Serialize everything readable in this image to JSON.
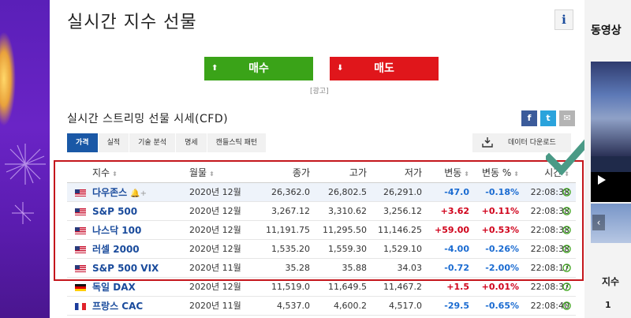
{
  "page": {
    "title": "실시간 지수 선물",
    "info_label": "i"
  },
  "actions": {
    "buy_label": "매수",
    "sell_label": "매도",
    "ad_label": "[광고]"
  },
  "section": {
    "title": "실시간 스트리밍 선물 시세(CFD)",
    "share": {
      "facebook": "f",
      "twitter": "t",
      "email": "✉"
    }
  },
  "tabs": [
    {
      "label": "가격",
      "active": true
    },
    {
      "label": "실적",
      "active": false
    },
    {
      "label": "기술 분석",
      "active": false
    },
    {
      "label": "명세",
      "active": false
    },
    {
      "label": "캔들스틱 패턴",
      "active": false
    }
  ],
  "download": {
    "label": "데이터 다운로드"
  },
  "table": {
    "headers": {
      "name": "지수",
      "month": "월물",
      "close": "종가",
      "high": "고가",
      "low": "저가",
      "change": "변동",
      "change_pct": "변동 %",
      "time": "시간"
    },
    "rows": [
      {
        "flag": "us",
        "name": "다우존스",
        "alert": "🔔+",
        "month": "2020년 12월",
        "close": "26,362.0",
        "high": "26,802.5",
        "low": "26,291.0",
        "change": "-47.0",
        "change_pct": "-0.18%",
        "time": "22:08:38",
        "direction": "neg"
      },
      {
        "flag": "us",
        "name": "S&P 500",
        "month": "2020년 12월",
        "close": "3,267.12",
        "high": "3,310.62",
        "low": "3,256.12",
        "change": "+3.62",
        "change_pct": "+0.11%",
        "time": "22:08:38",
        "direction": "pos"
      },
      {
        "flag": "us",
        "name": "나스닥 100",
        "month": "2020년 12월",
        "close": "11,191.75",
        "high": "11,295.50",
        "low": "11,146.25",
        "change": "+59.00",
        "change_pct": "+0.53%",
        "time": "22:08:38",
        "direction": "pos"
      },
      {
        "flag": "us",
        "name": "러셀 2000",
        "month": "2020년 12월",
        "close": "1,535.20",
        "high": "1,559.30",
        "low": "1,529.10",
        "change": "-4.00",
        "change_pct": "-0.26%",
        "time": "22:08:38",
        "direction": "neg"
      },
      {
        "flag": "us",
        "name": "S&P 500 VIX",
        "month": "2020년 11월",
        "close": "35.28",
        "high": "35.88",
        "low": "34.03",
        "change": "-0.72",
        "change_pct": "-2.00%",
        "time": "22:08:17",
        "direction": "neg"
      },
      {
        "flag": "de",
        "name": "독일 DAX",
        "month": "2020년 12월",
        "close": "11,519.0",
        "high": "11,649.5",
        "low": "11,467.2",
        "change": "+1.5",
        "change_pct": "+0.01%",
        "time": "22:08:37",
        "direction": "pos"
      },
      {
        "flag": "fr",
        "name": "프랑스 CAC",
        "month": "2020년 11월",
        "close": "4,537.0",
        "high": "4,600.2",
        "low": "4,517.0",
        "change": "-29.5",
        "change_pct": "-0.65%",
        "time": "22:08:40",
        "direction": "neg"
      }
    ]
  },
  "sidebar": {
    "title": "동영상",
    "sub_title": "지수",
    "rank": "1"
  },
  "colors": {
    "buy": "#3aa318",
    "sell": "#e0161b",
    "positive": "#d0021b",
    "negative": "#1a6bd1",
    "tab_active": "#1a58a6",
    "highlight_box": "#c4161c",
    "checkmark": "#4a9a86"
  }
}
